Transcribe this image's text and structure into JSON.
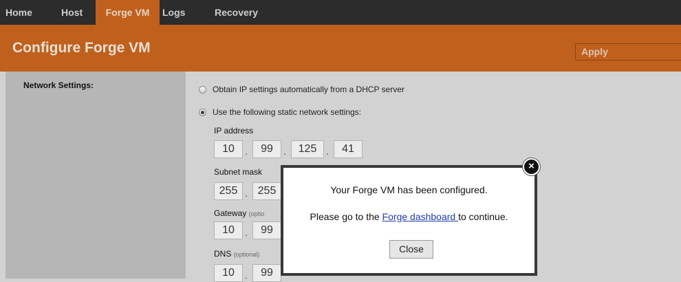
{
  "nav": {
    "items": [
      {
        "label": "Home"
      },
      {
        "label": "Host"
      },
      {
        "label": "Forge VM"
      },
      {
        "label": "Logs"
      },
      {
        "label": "Recovery"
      }
    ],
    "active": "Forge VM"
  },
  "header": {
    "title": "Configure Forge VM",
    "apply_label": "Apply"
  },
  "network": {
    "section_label": "Network Settings:",
    "dhcp_label": "Obtain IP settings automatically from a DHCP server",
    "static_label": "Use the following static network settings:",
    "selected": "static",
    "ip_label": "IP address",
    "ip": [
      "10",
      "99",
      "125",
      "41"
    ],
    "subnet_label": "Subnet mask",
    "subnet_visible": [
      "255",
      "255"
    ],
    "gateway_label": "Gateway",
    "gateway_optional": "(optio",
    "gateway_visible": [
      "10",
      "99"
    ],
    "dns_label": "DNS",
    "dns_optional": "(optional)",
    "dns_visible": [
      "10",
      "99"
    ]
  },
  "dialog": {
    "line1": "Your Forge VM has been configured.",
    "line2_prefix": "Please go to the ",
    "link_text": "Forge dashboard ",
    "line2_suffix": "to continue.",
    "close_label": "Close",
    "close_icon": "close-x-circle-icon"
  },
  "colors": {
    "nav_bg": "#2c2c2c",
    "accent": "#c0601d",
    "sidebar": "#b6b6b6",
    "content_bg": "#d2d2d2",
    "link": "#1f3da8"
  }
}
